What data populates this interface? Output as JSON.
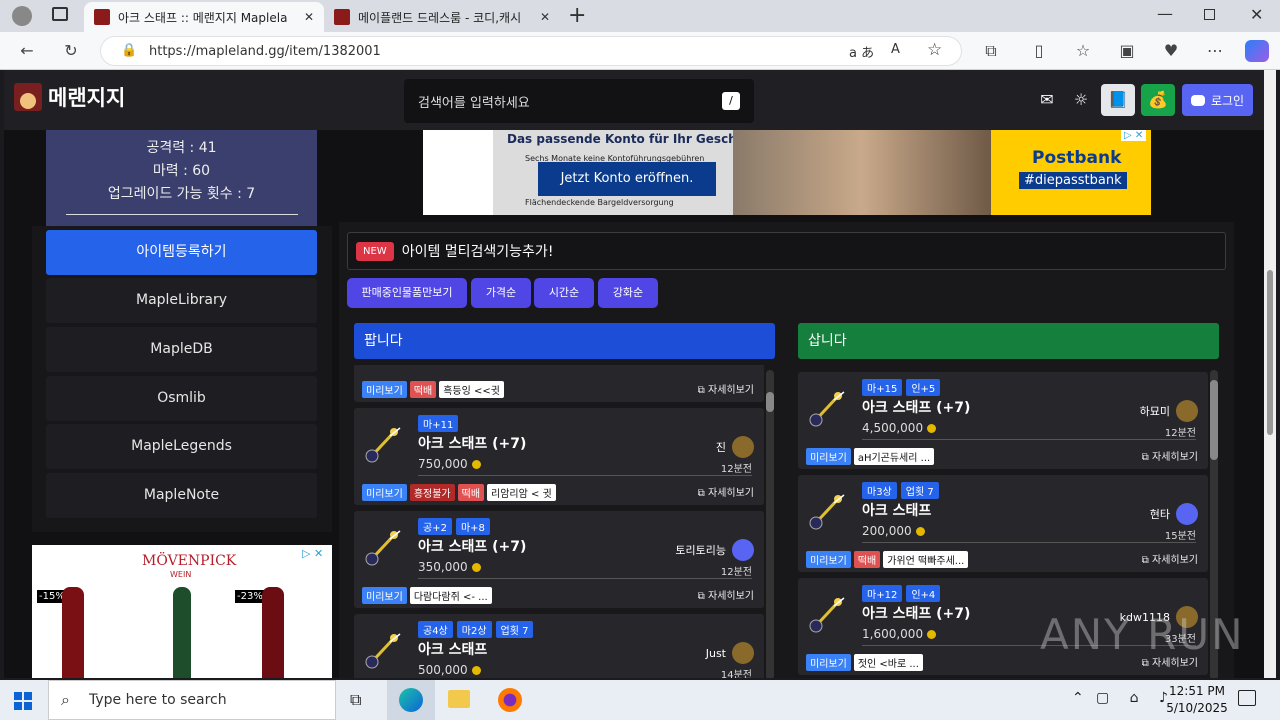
{
  "browser": {
    "tabs": [
      {
        "title": "아크 스태프 :: 메랜지지 Maplela",
        "active": true
      },
      {
        "title": "메이플랜드 드레스룸 - 코디,캐시",
        "active": false
      }
    ],
    "url": "https://mapleland.gg/item/1382001"
  },
  "header": {
    "logo": "메랜지지",
    "search_placeholder": "검색어를 입력하세요",
    "search_shortcut": "/",
    "login": "로그인"
  },
  "infobox": {
    "lines": [
      "공격력 : 41",
      "마력 : 60",
      "업그레이드 가능 횟수 : 7"
    ]
  },
  "sidebar": {
    "items": [
      "아이템등록하기",
      "MapleLibrary",
      "MapleDB",
      "Osmlib",
      "MapleLegends",
      "MapleNote"
    ]
  },
  "notice": {
    "tag": "NEW",
    "text": "아이템 멀티검색기능추가!"
  },
  "sort_buttons": [
    "판매중인물품만보기",
    "가격순",
    "시간순",
    "강화순"
  ],
  "sell": {
    "header": "팝니다",
    "partial": {
      "tags": [
        "미리보기",
        "떡배"
      ],
      "memo": "흑등잉 <<귓",
      "detail": "자세히보기"
    },
    "cards": [
      {
        "tags": [
          "마+11"
        ],
        "name": "아크 스태프 (+7)",
        "seller": "진",
        "price": "750,000",
        "time": "12분전",
        "preview": "미리보기",
        "badges": [
          "흥정불가",
          "떡배"
        ],
        "memo": "리암리암 < 귓",
        "detail": "자세히보기"
      },
      {
        "tags": [
          "공+2",
          "마+8"
        ],
        "name": "아크 스태프 (+7)",
        "seller": "토리토리능",
        "price": "350,000",
        "time": "12분전",
        "preview": "미리보기",
        "badges": [],
        "memo": "다람다람쥐 <- ...",
        "detail": "자세히보기"
      },
      {
        "tags": [
          "공4상",
          "마2상",
          "업횟 7"
        ],
        "name": "아크 스태프",
        "seller": "Just",
        "price": "500,000",
        "time": "14분전",
        "preview": "미리보기",
        "badges": [],
        "memo": "",
        "detail": "자세히보기"
      }
    ]
  },
  "buy": {
    "header": "삽니다",
    "cards": [
      {
        "tags": [
          "마+15",
          "인+5"
        ],
        "name": "아크 스태프 (+7)",
        "seller": "하묘미",
        "price": "4,500,000",
        "time": "12분전",
        "preview": "미리보기",
        "badges": [],
        "memo": "aH기곤듀세리 ...",
        "detail": "자세히보기"
      },
      {
        "tags": [
          "마3상",
          "업횟 7"
        ],
        "name": "아크 스태프",
        "seller": "현타",
        "price": "200,000",
        "time": "15분전",
        "preview": "미리보기",
        "badges": [
          "떡배"
        ],
        "memo": "가위언 떡빠주세...",
        "detail": "자세히보기"
      },
      {
        "tags": [
          "마+12",
          "인+4"
        ],
        "name": "아크 스태프 (+7)",
        "seller": "kdw1118",
        "price": "1,600,000",
        "time": "33분전",
        "preview": "미리보기",
        "badges": [],
        "memo": "젓인 <바로 ...",
        "detail": "자세히보기"
      }
    ]
  },
  "ads": {
    "banner": {
      "headline": "Das passende Konto für Ihr Geschäft",
      "cta": "Jetzt Konto eröffnen.",
      "brand": "Postbank",
      "tagline": "#diepasstbank",
      "lines": [
        "Sechs Monate keine Kontoführungsgebühren",
        "Flächendeckende Bargeldversorgung"
      ]
    },
    "side": {
      "brand": "MÖVENPICK",
      "sub": "WEIN",
      "discounts": [
        "-15%",
        "-23%"
      ]
    }
  },
  "taskbar": {
    "search": "Type here to search",
    "time": "12:51 PM",
    "date": "5/10/2025"
  },
  "watermark": "ANY RUN",
  "colors": {
    "sell_header": "#1d4ed8",
    "buy_header": "#15803d",
    "accent": "#4f46e5",
    "login": "#5865f2"
  }
}
